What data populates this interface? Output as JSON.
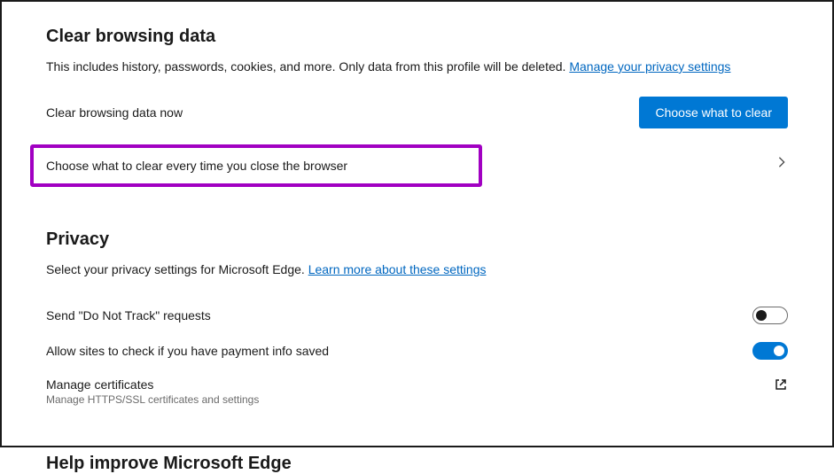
{
  "clearData": {
    "title": "Clear browsing data",
    "desc": "This includes history, passwords, cookies, and more. Only data from this profile will be deleted. ",
    "descLink": "Manage your privacy settings",
    "nowLabel": "Clear browsing data now",
    "buttonLabel": "Choose what to clear",
    "onCloseLabel": "Choose what to clear every time you close the browser"
  },
  "privacy": {
    "title": "Privacy",
    "desc": "Select your privacy settings for Microsoft Edge. ",
    "descLink": "Learn more about these settings",
    "dntLabel": "Send \"Do Not Track\" requests",
    "paymentLabel": "Allow sites to check if you have payment info saved",
    "certLabel": "Manage certificates",
    "certSubLabel": "Manage HTTPS/SSL certificates and settings"
  },
  "help": {
    "title": "Help improve Microsoft Edge"
  }
}
